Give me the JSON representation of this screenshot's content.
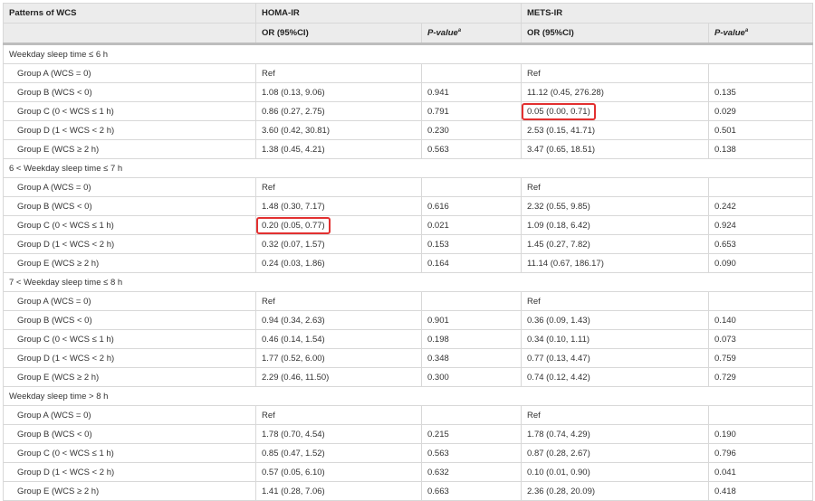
{
  "header": {
    "col1": "Patterns of WCS",
    "homa": "HOMA-IR",
    "mets": "METS-IR",
    "or_label": "OR (95%CI)",
    "p_label": "P-value",
    "p_sup": "a"
  },
  "sections": [
    {
      "title": "Weekday sleep time ≤ 6 h",
      "rows": [
        {
          "group": "Group A (WCS = 0)",
          "homa_or": "Ref",
          "homa_p": "",
          "mets_or": "Ref",
          "mets_p": ""
        },
        {
          "group": "Group B (WCS < 0)",
          "homa_or": "1.08 (0.13, 9.06)",
          "homa_p": "0.941",
          "mets_or": "11.12 (0.45, 276.28)",
          "mets_p": "0.135"
        },
        {
          "group": "Group C (0 < WCS ≤ 1 h)",
          "homa_or": "0.86 (0.27, 2.75)",
          "homa_p": "0.791",
          "mets_or": "0.05 (0.00, 0.71)",
          "mets_p": "0.029",
          "mets_highlight": true
        },
        {
          "group": "Group D (1 < WCS < 2 h)",
          "homa_or": "3.60 (0.42, 30.81)",
          "homa_p": "0.230",
          "mets_or": "2.53 (0.15, 41.71)",
          "mets_p": "0.501"
        },
        {
          "group": "Group E (WCS ≥ 2 h)",
          "homa_or": "1.38 (0.45, 4.21)",
          "homa_p": "0.563",
          "mets_or": "3.47 (0.65, 18.51)",
          "mets_p": "0.138"
        }
      ]
    },
    {
      "title": "6 < Weekday sleep time ≤ 7 h",
      "rows": [
        {
          "group": "Group A (WCS = 0)",
          "homa_or": "Ref",
          "homa_p": "",
          "mets_or": "Ref",
          "mets_p": ""
        },
        {
          "group": "Group B (WCS < 0)",
          "homa_or": "1.48 (0.30, 7.17)",
          "homa_p": "0.616",
          "mets_or": "2.32 (0.55, 9.85)",
          "mets_p": "0.242"
        },
        {
          "group": "Group C (0 < WCS ≤ 1 h)",
          "homa_or": "0.20 (0.05, 0.77)",
          "homa_p": "0.021",
          "mets_or": "1.09 (0.18, 6.42)",
          "mets_p": "0.924",
          "homa_highlight": true
        },
        {
          "group": "Group D (1 < WCS < 2 h)",
          "homa_or": "0.32 (0.07, 1.57)",
          "homa_p": "0.153",
          "mets_or": "1.45 (0.27, 7.82)",
          "mets_p": "0.653"
        },
        {
          "group": "Group E (WCS ≥ 2 h)",
          "homa_or": "0.24 (0.03, 1.86)",
          "homa_p": "0.164",
          "mets_or": "11.14 (0.67, 186.17)",
          "mets_p": "0.090"
        }
      ]
    },
    {
      "title": "7 < Weekday sleep time ≤ 8 h",
      "rows": [
        {
          "group": "Group A (WCS = 0)",
          "homa_or": "Ref",
          "homa_p": "",
          "mets_or": "Ref",
          "mets_p": ""
        },
        {
          "group": "Group B (WCS < 0)",
          "homa_or": "0.94 (0.34, 2.63)",
          "homa_p": "0.901",
          "mets_or": "0.36 (0.09, 1.43)",
          "mets_p": "0.140"
        },
        {
          "group": "Group C (0 < WCS ≤ 1 h)",
          "homa_or": "0.46 (0.14, 1.54)",
          "homa_p": "0.198",
          "mets_or": "0.34 (0.10, 1.11)",
          "mets_p": "0.073"
        },
        {
          "group": "Group D (1 < WCS < 2 h)",
          "homa_or": "1.77 (0.52, 6.00)",
          "homa_p": "0.348",
          "mets_or": "0.77 (0.13, 4.47)",
          "mets_p": "0.759"
        },
        {
          "group": "Group E (WCS ≥ 2 h)",
          "homa_or": "2.29 (0.46, 11.50)",
          "homa_p": "0.300",
          "mets_or": "0.74 (0.12, 4.42)",
          "mets_p": "0.729"
        }
      ]
    },
    {
      "title": "Weekday sleep time > 8 h",
      "rows": [
        {
          "group": "Group A (WCS = 0)",
          "homa_or": "Ref",
          "homa_p": "",
          "mets_or": "Ref",
          "mets_p": ""
        },
        {
          "group": "Group B (WCS < 0)",
          "homa_or": "1.78 (0.70, 4.54)",
          "homa_p": "0.215",
          "mets_or": "1.78 (0.74, 4.29)",
          "mets_p": "0.190"
        },
        {
          "group": "Group C (0 < WCS ≤ 1 h)",
          "homa_or": "0.85 (0.47, 1.52)",
          "homa_p": "0.563",
          "mets_or": "0.87 (0.28, 2.67)",
          "mets_p": "0.796"
        },
        {
          "group": "Group D (1 < WCS < 2 h)",
          "homa_or": "0.57 (0.05, 6.10)",
          "homa_p": "0.632",
          "mets_or": "0.10 (0.01, 0.90)",
          "mets_p": "0.041"
        },
        {
          "group": "Group E (WCS ≥ 2 h)",
          "homa_or": "1.41 (0.28, 7.06)",
          "homa_p": "0.663",
          "mets_or": "2.36 (0.28, 20.09)",
          "mets_p": "0.418"
        }
      ]
    }
  ],
  "colors": {
    "highlight": "#e23030",
    "header_bg": "#ececec",
    "border": "#d8d8d8"
  }
}
